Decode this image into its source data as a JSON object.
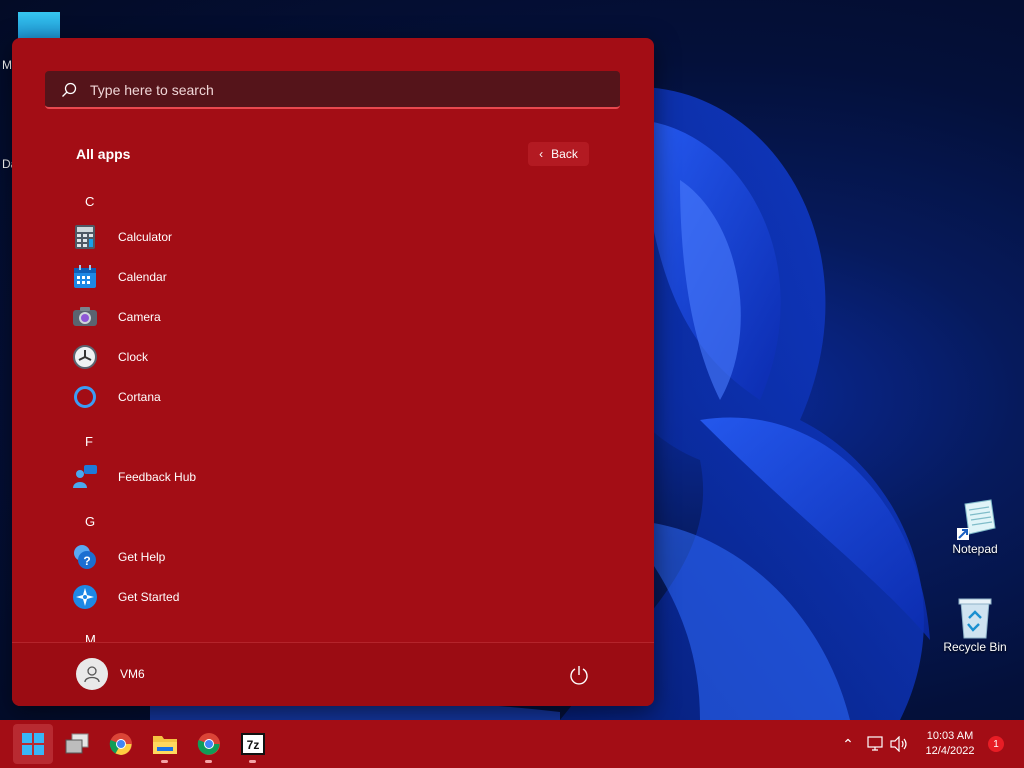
{
  "desktop": {
    "icons": [
      {
        "label": "Notepad"
      },
      {
        "label": "Recycle Bin"
      }
    ],
    "partial_labels": [
      "M",
      "Da"
    ]
  },
  "start_menu": {
    "search": {
      "placeholder": "Type here to search",
      "value": ""
    },
    "title": "All apps",
    "back_label": "Back",
    "sections": [
      {
        "letter": "C",
        "apps": [
          {
            "name": "Calculator",
            "icon": "calculator-icon"
          },
          {
            "name": "Calendar",
            "icon": "calendar-icon"
          },
          {
            "name": "Camera",
            "icon": "camera-icon"
          },
          {
            "name": "Clock",
            "icon": "clock-icon"
          },
          {
            "name": "Cortana",
            "icon": "cortana-icon"
          }
        ]
      },
      {
        "letter": "F",
        "apps": [
          {
            "name": "Feedback Hub",
            "icon": "feedback-hub-icon"
          }
        ]
      },
      {
        "letter": "G",
        "apps": [
          {
            "name": "Get Help",
            "icon": "get-help-icon"
          },
          {
            "name": "Get Started",
            "icon": "get-started-icon"
          }
        ]
      },
      {
        "letter": "M",
        "apps": []
      }
    ],
    "user": {
      "name": "VM6"
    },
    "power_icon": "power-icon"
  },
  "taskbar": {
    "apps": [
      "start-icon",
      "task-view-icon",
      "chrome-icon",
      "file-explorer-icon",
      "chrome-icon",
      "7zip-icon"
    ],
    "tray": {
      "time": "10:03 AM",
      "date": "12/4/2022",
      "notification_count": "1"
    }
  },
  "colors": {
    "accent": "#a30d15",
    "search_bg": "#55141a"
  }
}
